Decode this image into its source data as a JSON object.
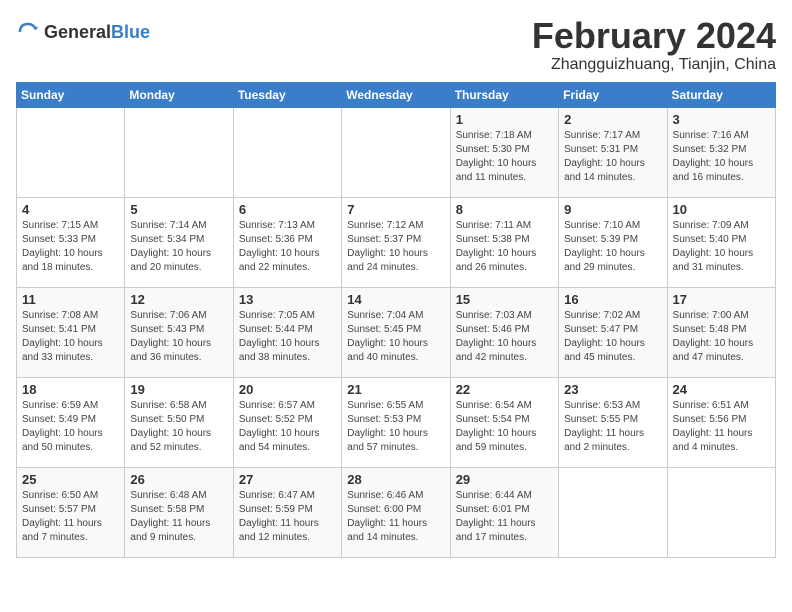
{
  "logo": {
    "general": "General",
    "blue": "Blue"
  },
  "title": "February 2024",
  "location": "Zhangguizhuang, Tianjin, China",
  "days_of_week": [
    "Sunday",
    "Monday",
    "Tuesday",
    "Wednesday",
    "Thursday",
    "Friday",
    "Saturday"
  ],
  "weeks": [
    [
      {
        "day": "",
        "info": ""
      },
      {
        "day": "",
        "info": ""
      },
      {
        "day": "",
        "info": ""
      },
      {
        "day": "",
        "info": ""
      },
      {
        "day": "1",
        "info": "Sunrise: 7:18 AM\nSunset: 5:30 PM\nDaylight: 10 hours\nand 11 minutes."
      },
      {
        "day": "2",
        "info": "Sunrise: 7:17 AM\nSunset: 5:31 PM\nDaylight: 10 hours\nand 14 minutes."
      },
      {
        "day": "3",
        "info": "Sunrise: 7:16 AM\nSunset: 5:32 PM\nDaylight: 10 hours\nand 16 minutes."
      }
    ],
    [
      {
        "day": "4",
        "info": "Sunrise: 7:15 AM\nSunset: 5:33 PM\nDaylight: 10 hours\nand 18 minutes."
      },
      {
        "day": "5",
        "info": "Sunrise: 7:14 AM\nSunset: 5:34 PM\nDaylight: 10 hours\nand 20 minutes."
      },
      {
        "day": "6",
        "info": "Sunrise: 7:13 AM\nSunset: 5:36 PM\nDaylight: 10 hours\nand 22 minutes."
      },
      {
        "day": "7",
        "info": "Sunrise: 7:12 AM\nSunset: 5:37 PM\nDaylight: 10 hours\nand 24 minutes."
      },
      {
        "day": "8",
        "info": "Sunrise: 7:11 AM\nSunset: 5:38 PM\nDaylight: 10 hours\nand 26 minutes."
      },
      {
        "day": "9",
        "info": "Sunrise: 7:10 AM\nSunset: 5:39 PM\nDaylight: 10 hours\nand 29 minutes."
      },
      {
        "day": "10",
        "info": "Sunrise: 7:09 AM\nSunset: 5:40 PM\nDaylight: 10 hours\nand 31 minutes."
      }
    ],
    [
      {
        "day": "11",
        "info": "Sunrise: 7:08 AM\nSunset: 5:41 PM\nDaylight: 10 hours\nand 33 minutes."
      },
      {
        "day": "12",
        "info": "Sunrise: 7:06 AM\nSunset: 5:43 PM\nDaylight: 10 hours\nand 36 minutes."
      },
      {
        "day": "13",
        "info": "Sunrise: 7:05 AM\nSunset: 5:44 PM\nDaylight: 10 hours\nand 38 minutes."
      },
      {
        "day": "14",
        "info": "Sunrise: 7:04 AM\nSunset: 5:45 PM\nDaylight: 10 hours\nand 40 minutes."
      },
      {
        "day": "15",
        "info": "Sunrise: 7:03 AM\nSunset: 5:46 PM\nDaylight: 10 hours\nand 42 minutes."
      },
      {
        "day": "16",
        "info": "Sunrise: 7:02 AM\nSunset: 5:47 PM\nDaylight: 10 hours\nand 45 minutes."
      },
      {
        "day": "17",
        "info": "Sunrise: 7:00 AM\nSunset: 5:48 PM\nDaylight: 10 hours\nand 47 minutes."
      }
    ],
    [
      {
        "day": "18",
        "info": "Sunrise: 6:59 AM\nSunset: 5:49 PM\nDaylight: 10 hours\nand 50 minutes."
      },
      {
        "day": "19",
        "info": "Sunrise: 6:58 AM\nSunset: 5:50 PM\nDaylight: 10 hours\nand 52 minutes."
      },
      {
        "day": "20",
        "info": "Sunrise: 6:57 AM\nSunset: 5:52 PM\nDaylight: 10 hours\nand 54 minutes."
      },
      {
        "day": "21",
        "info": "Sunrise: 6:55 AM\nSunset: 5:53 PM\nDaylight: 10 hours\nand 57 minutes."
      },
      {
        "day": "22",
        "info": "Sunrise: 6:54 AM\nSunset: 5:54 PM\nDaylight: 10 hours\nand 59 minutes."
      },
      {
        "day": "23",
        "info": "Sunrise: 6:53 AM\nSunset: 5:55 PM\nDaylight: 11 hours\nand 2 minutes."
      },
      {
        "day": "24",
        "info": "Sunrise: 6:51 AM\nSunset: 5:56 PM\nDaylight: 11 hours\nand 4 minutes."
      }
    ],
    [
      {
        "day": "25",
        "info": "Sunrise: 6:50 AM\nSunset: 5:57 PM\nDaylight: 11 hours\nand 7 minutes."
      },
      {
        "day": "26",
        "info": "Sunrise: 6:48 AM\nSunset: 5:58 PM\nDaylight: 11 hours\nand 9 minutes."
      },
      {
        "day": "27",
        "info": "Sunrise: 6:47 AM\nSunset: 5:59 PM\nDaylight: 11 hours\nand 12 minutes."
      },
      {
        "day": "28",
        "info": "Sunrise: 6:46 AM\nSunset: 6:00 PM\nDaylight: 11 hours\nand 14 minutes."
      },
      {
        "day": "29",
        "info": "Sunrise: 6:44 AM\nSunset: 6:01 PM\nDaylight: 11 hours\nand 17 minutes."
      },
      {
        "day": "",
        "info": ""
      },
      {
        "day": "",
        "info": ""
      }
    ]
  ]
}
